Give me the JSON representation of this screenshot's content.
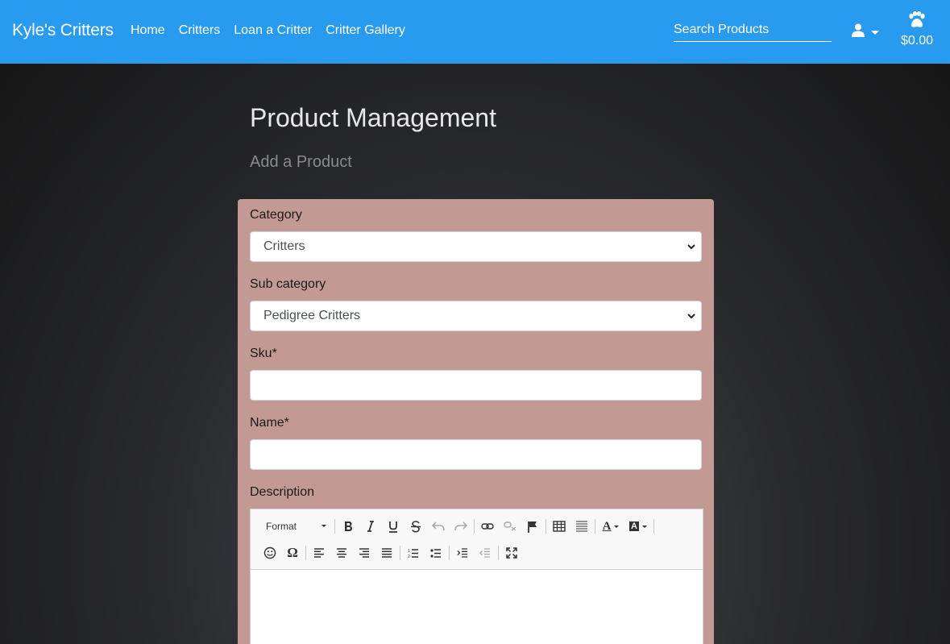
{
  "nav": {
    "brand": "Kyle's Critters",
    "links": [
      "Home",
      "Critters",
      "Loan a Critter",
      "Critter Gallery"
    ],
    "search_placeholder": "Search Products",
    "cart_total": "$0.00"
  },
  "page": {
    "title": "Product Management",
    "subtitle": "Add a Product"
  },
  "form": {
    "category": {
      "label": "Category",
      "value": "Critters"
    },
    "sub_category": {
      "label": "Sub category",
      "value": "Pedigree Critters"
    },
    "sku": {
      "label": "Sku*",
      "value": ""
    },
    "name": {
      "label": "Name*",
      "value": ""
    },
    "description": {
      "label": "Description",
      "format_label": "Format",
      "toolbar_row1": [
        "bold-icon",
        "italic-icon",
        "underline-icon",
        "strikethrough-icon",
        "undo-icon",
        "redo-icon",
        "link-icon",
        "unlink-icon",
        "anchor-flag-icon",
        "table-icon",
        "horizontal-rule-icon",
        "text-color-icon",
        "background-color-icon"
      ],
      "toolbar_row2": [
        "smiley-icon",
        "special-char-icon",
        "align-left-icon",
        "align-center-icon",
        "align-right-icon",
        "align-justify-icon",
        "numbered-list-icon",
        "bulleted-list-icon",
        "indent-icon",
        "outdent-icon",
        "maximize-icon"
      ]
    }
  },
  "colors": {
    "navbar": "#289bf0",
    "form_card": "#c39993",
    "background": "#1c1c1e"
  }
}
